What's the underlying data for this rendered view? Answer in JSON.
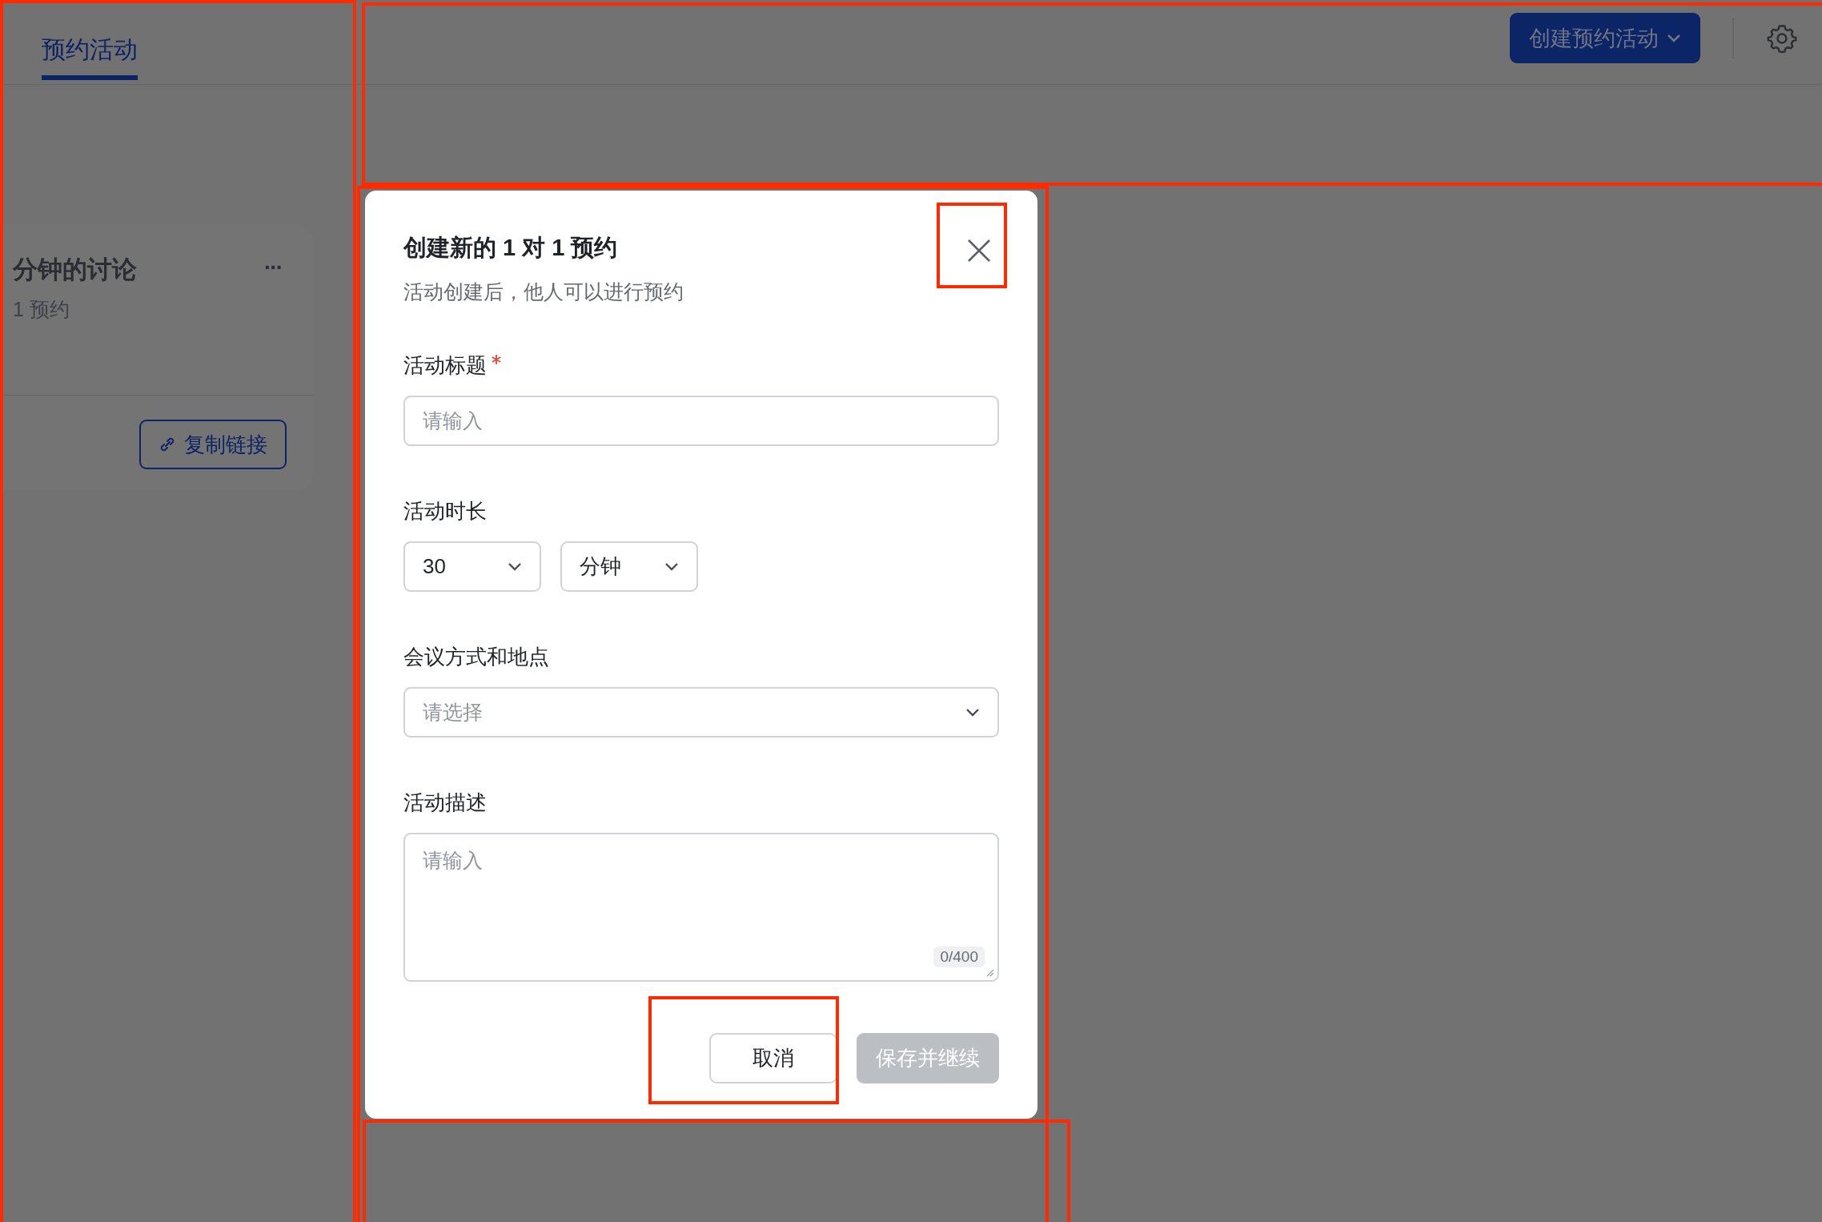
{
  "tabs": [
    {
      "label": "预约活动",
      "selected": true
    }
  ],
  "header": {
    "create_button": "创建预约活动"
  },
  "event_card": {
    "title": "分钟的讨论",
    "subtitle": "1 预约",
    "more": "···",
    "copy_link": "复制链接"
  },
  "dialog": {
    "title": "创建新的 1 对 1 预约",
    "subtitle": "活动创建后，他人可以进行预约",
    "fields": [
      {
        "kind": "input",
        "label": "活动标题",
        "required": true,
        "placeholder": "请输入"
      },
      {
        "kind": "duration",
        "label": "活动时长",
        "required": false,
        "selects": [
          {
            "value": "30"
          },
          {
            "value": "分钟"
          }
        ]
      },
      {
        "kind": "select",
        "label": "会议方式和地点",
        "required": false,
        "placeholder": "请选择"
      },
      {
        "kind": "textarea",
        "label": "活动描述",
        "required": false,
        "placeholder": "请输入",
        "counter": "0/400"
      }
    ],
    "buttons": [
      {
        "label": "取消",
        "kind": "secondary",
        "disabled": false
      },
      {
        "label": "保存并继续",
        "kind": "primary",
        "disabled": true
      }
    ]
  }
}
